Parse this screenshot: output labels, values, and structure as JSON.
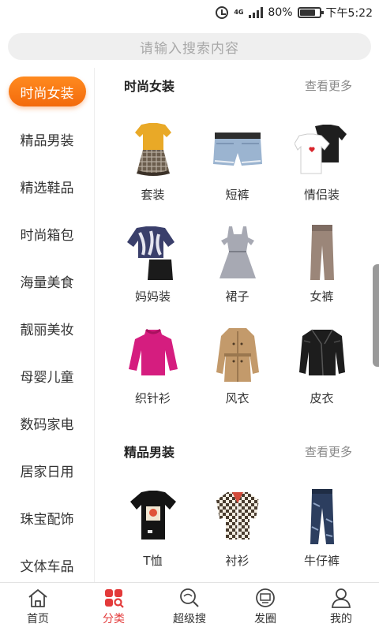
{
  "status": {
    "battery": "80%",
    "time": "下午5:22",
    "network": "4G"
  },
  "search": {
    "placeholder": "请输入搜索内容"
  },
  "sidebar": {
    "active_index": 0,
    "items": [
      {
        "label": "时尚女装"
      },
      {
        "label": "精品男装"
      },
      {
        "label": "精选鞋品"
      },
      {
        "label": "时尚箱包"
      },
      {
        "label": "海量美食"
      },
      {
        "label": "靓丽美妆"
      },
      {
        "label": "母婴儿童"
      },
      {
        "label": "数码家电"
      },
      {
        "label": "居家日用"
      },
      {
        "label": "珠宝配饰"
      },
      {
        "label": "文体车品"
      }
    ]
  },
  "sections": [
    {
      "title": "时尚女装",
      "more": "查看更多",
      "items": [
        {
          "label": "套装",
          "icon": "outfit-set-image"
        },
        {
          "label": "短裤",
          "icon": "shorts-image"
        },
        {
          "label": "情侣装",
          "icon": "couple-tshirts-image"
        },
        {
          "label": "妈妈装",
          "icon": "mom-outfit-image"
        },
        {
          "label": "裙子",
          "icon": "dress-image"
        },
        {
          "label": "女裤",
          "icon": "women-pants-image"
        },
        {
          "label": "织针衫",
          "icon": "knit-sweater-image"
        },
        {
          "label": "风衣",
          "icon": "trench-coat-image"
        },
        {
          "label": "皮衣",
          "icon": "leather-jacket-image"
        }
      ]
    },
    {
      "title": "精品男装",
      "more": "查看更多",
      "items": [
        {
          "label": "T恤",
          "icon": "tshirt-image"
        },
        {
          "label": "衬衫",
          "icon": "shirt-image"
        },
        {
          "label": "牛仔裤",
          "icon": "jeans-image"
        }
      ]
    }
  ],
  "bottom_nav": {
    "active_index": 1,
    "items": [
      {
        "label": "首页",
        "icon": "home-icon"
      },
      {
        "label": "分类",
        "icon": "category-icon"
      },
      {
        "label": "超级搜",
        "icon": "super-search-icon"
      },
      {
        "label": "发圈",
        "icon": "share-circle-icon"
      },
      {
        "label": "我的",
        "icon": "profile-icon"
      }
    ]
  },
  "colors": {
    "accent": "#f36a0c",
    "nav_active": "#e33a3a"
  }
}
